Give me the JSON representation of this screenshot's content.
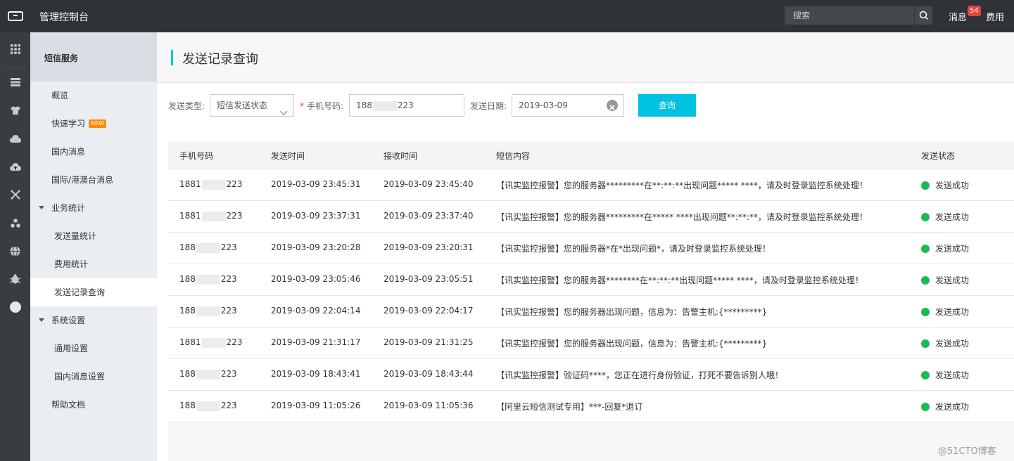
{
  "topbar": {
    "title": "管理控制台",
    "search_placeholder": "搜索",
    "messages_label": "消息",
    "messages_count": "54",
    "fee_label": "费用"
  },
  "rail_icons": [
    "grid-icon",
    "server-icon",
    "shirt-icon",
    "cloud-icon",
    "cloud-upload-icon",
    "network-icon",
    "cluster-icon",
    "globe-icon",
    "bug-icon",
    "circle-icon"
  ],
  "sidebar": {
    "header": "短信服务",
    "items": [
      {
        "label": "概览",
        "indent": 1
      },
      {
        "label": "快速学习",
        "indent": 1,
        "badge": "NEW"
      },
      {
        "label": "国内消息",
        "indent": 1
      },
      {
        "label": "国际/港澳台消息",
        "indent": 1
      },
      {
        "label": "业务统计",
        "indent": 0,
        "expandable": true
      },
      {
        "label": "发送量统计",
        "indent": 2
      },
      {
        "label": "费用统计",
        "indent": 2
      },
      {
        "label": "发送记录查询",
        "indent": 2,
        "active": true
      },
      {
        "label": "系统设置",
        "indent": 0,
        "expandable": true
      },
      {
        "label": "通用设置",
        "indent": 2
      },
      {
        "label": "国内消息设置",
        "indent": 2
      },
      {
        "label": "帮助文档",
        "indent": 1
      }
    ]
  },
  "page": {
    "title": "发送记录查询"
  },
  "filter": {
    "type_label": "发送类型:",
    "type_value": "短信发送状态",
    "phone_label": "手机号码:",
    "phone_prefix": "188",
    "phone_suffix": "223",
    "date_label": "发送日期:",
    "date_value": "2019-03-09",
    "query_label": "查询"
  },
  "table": {
    "headers": [
      "手机号码",
      "发送时间",
      "接收时间",
      "短信内容",
      "发送状态"
    ],
    "rows": [
      {
        "phone_prefix": "1881",
        "phone_suffix": "223",
        "send": "2019-03-09 23:45:31",
        "recv": "2019-03-09 23:45:40",
        "content": "【讯实监控报警】您的服务器*********在**:**:**出现问题***** ****，请及时登录监控系统处理！",
        "status": "发送成功"
      },
      {
        "phone_prefix": "1881",
        "phone_suffix": "223",
        "send": "2019-03-09 23:37:31",
        "recv": "2019-03-09 23:37:40",
        "content": "【讯实监控报警】您的服务器*********在***** ****出现问题**:**:**，请及时登录监控系统处理！",
        "status": "发送成功"
      },
      {
        "phone_prefix": "188",
        "phone_suffix": "223",
        "send": "2019-03-09 23:20:28",
        "recv": "2019-03-09 23:20:31",
        "content": "【讯实监控报警】您的服务器*在*出现问题*，请及时登录监控系统处理！",
        "status": "发送成功"
      },
      {
        "phone_prefix": "188",
        "phone_suffix": "223",
        "send": "2019-03-09 23:05:46",
        "recv": "2019-03-09 23:05:51",
        "content": "【讯实监控报警】您的服务器********在**:**:**出现问题***** ****，请及时登录监控系统处理！",
        "status": "发送成功"
      },
      {
        "phone_prefix": "188",
        "phone_suffix": "223",
        "send": "2019-03-09 22:04:14",
        "recv": "2019-03-09 22:04:17",
        "content": "【讯实监控报警】您的服务器出现问题，信息为：告警主机:{*********}",
        "status": "发送成功"
      },
      {
        "phone_prefix": "1881",
        "phone_suffix": "223",
        "send": "2019-03-09 21:31:17",
        "recv": "2019-03-09 21:31:25",
        "content": "【讯实监控报警】您的服务器出现问题，信息为：告警主机:{*********}",
        "status": "发送成功"
      },
      {
        "phone_prefix": "188",
        "phone_suffix": "223",
        "send": "2019-03-09 18:43:41",
        "recv": "2019-03-09 18:43:44",
        "content": "【讯实监控报警】验证码****，您正在进行身份验证，打死不要告诉别人哦！",
        "status": "发送成功"
      },
      {
        "phone_prefix": "188",
        "phone_suffix": "223",
        "send": "2019-03-09 11:05:26",
        "recv": "2019-03-09 11:05:36",
        "content": "【阿里云短信测试专用】***-回复*退订",
        "status": "发送成功"
      }
    ]
  },
  "colors": {
    "accent": "#00c1de",
    "success": "#1db954",
    "topbar": "#2f3236",
    "rail": "#373d41",
    "sidebar": "#eaedf1"
  },
  "watermark": "@51CTO博客"
}
